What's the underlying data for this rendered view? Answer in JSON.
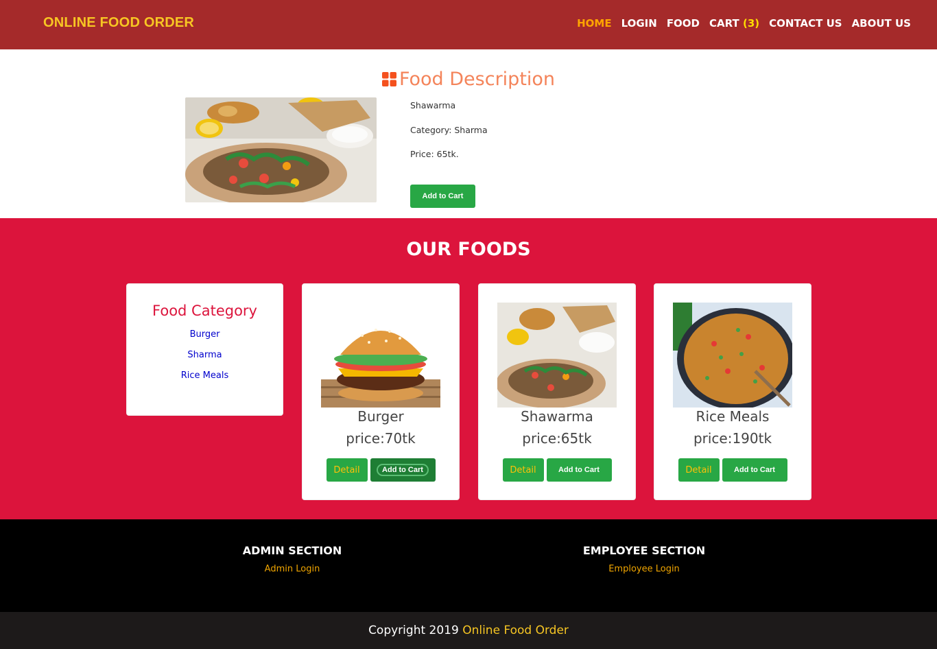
{
  "header": {
    "brand": "ONLINE FOOD ORDER",
    "nav": {
      "home": "HOME",
      "login": "LOGIN",
      "food": "FOOD",
      "cart": "CART",
      "cart_count": "(3)",
      "contact": "CONTACT US",
      "about": "ABOUT US"
    }
  },
  "description": {
    "title": "Food Description",
    "name": "Shawarma",
    "category": "Category: Sharma",
    "price": "Price: 65tk.",
    "add_to_cart": "Add to Cart"
  },
  "foods": {
    "title": "OUR FOODS",
    "category_title": "Food Category",
    "categories": [
      "Burger",
      "Sharma",
      "Rice Meals"
    ],
    "items": [
      {
        "name": "Burger",
        "price": "price:70tk",
        "detail": "Detail",
        "add_to_cart": "Add to Cart"
      },
      {
        "name": "Shawarma",
        "price": "price:65tk",
        "detail": "Detail",
        "add_to_cart": "Add to Cart"
      },
      {
        "name": "Rice Meals",
        "price": "price:190tk",
        "detail": "Detail",
        "add_to_cart": "Add to Cart"
      }
    ]
  },
  "footer": {
    "admin_title": "ADMIN SECTION",
    "admin_link": "Admin Login",
    "employee_title": "EMPLOYEE SECTION",
    "employee_link": "Employee Login",
    "copyright_prefix": "Copyright 2019",
    "copyright_brand": "Online Food Order"
  },
  "colors": {
    "header_bg": "#a52a2a",
    "brand": "#f7c623",
    "section_bg": "#dc143c",
    "accent": "#28a745",
    "title": "#f4845a"
  }
}
